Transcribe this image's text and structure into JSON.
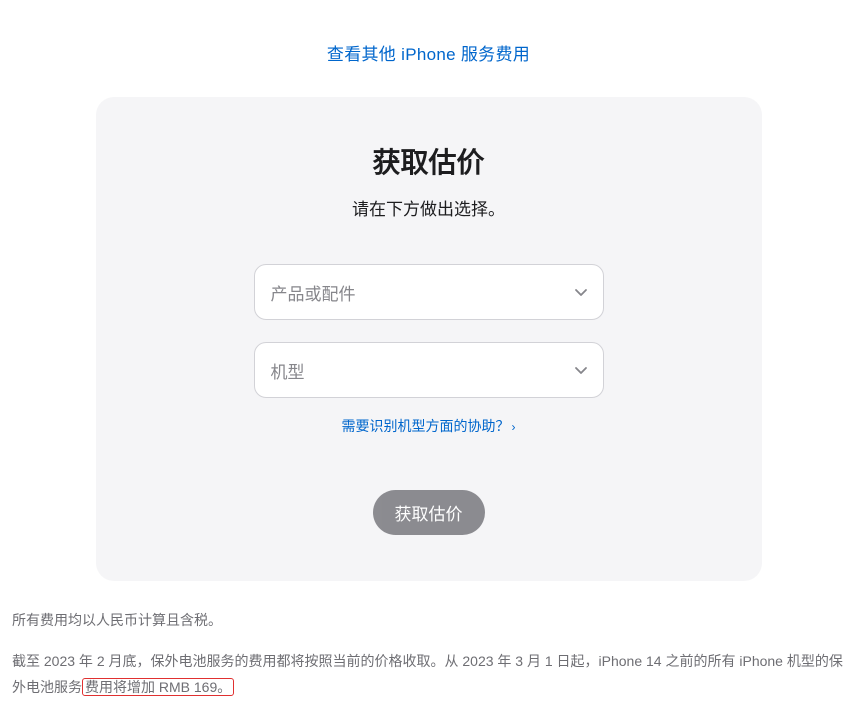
{
  "topLink": {
    "label": "查看其他 iPhone 服务费用"
  },
  "card": {
    "title": "获取估价",
    "subtitle": "请在下方做出选择。",
    "productSelect": {
      "placeholder": "产品或配件"
    },
    "modelSelect": {
      "placeholder": "机型"
    },
    "helpLink": {
      "label": "需要识别机型方面的协助？"
    },
    "submit": {
      "label": "获取估价"
    }
  },
  "footnotes": {
    "line1": "所有费用均以人民币计算且含税。",
    "line2_part1": "截至 2023 年 2 月底，保外电池服务的费用都将按照当前的价格收取。从 2023 年 3 月 1 日起，iPhone 14 之前的所有 iPhone 机型的保外电池服务",
    "line2_highlight": "费用将增加 RMB 169。"
  }
}
